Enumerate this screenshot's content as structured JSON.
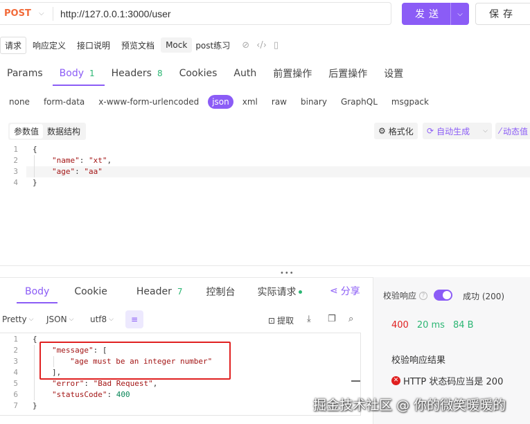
{
  "request": {
    "method": "POST",
    "url": "http://127.0.0.1:3000/user",
    "send_label": "发送",
    "save_label": "保存"
  },
  "subtabs": [
    {
      "label": "请求"
    },
    {
      "label": "响应定义"
    },
    {
      "label": "接口说明"
    },
    {
      "label": "预览文档"
    },
    {
      "label": "Mock"
    },
    {
      "label": "post练习"
    }
  ],
  "main_tabs": [
    {
      "label": "Params"
    },
    {
      "label": "Body",
      "count": "1"
    },
    {
      "label": "Headers",
      "count": "8"
    },
    {
      "label": "Cookies"
    },
    {
      "label": "Auth"
    },
    {
      "label": "前置操作"
    },
    {
      "label": "后置操作"
    },
    {
      "label": "设置"
    }
  ],
  "body_types": [
    "none",
    "form-data",
    "x-www-form-urlencoded",
    "json",
    "xml",
    "raw",
    "binary",
    "GraphQL",
    "msgpack"
  ],
  "editor": {
    "tabs": [
      "参数值",
      "数据结构"
    ],
    "format_label": "格式化",
    "auto_generate_label": "自动生成",
    "dynamic_label": "动态值"
  },
  "request_body": {
    "line_numbers": [
      "1",
      "2",
      "3",
      "4"
    ],
    "l1": "{",
    "l2_key": "\"name\"",
    "l2_val": "\"xt\"",
    "l3_key": "\"age\"",
    "l3_val": "\"aa\"",
    "l4": "}"
  },
  "response_tabs": [
    {
      "label": "Body"
    },
    {
      "label": "Cookie"
    },
    {
      "label": "Header",
      "count": "7"
    },
    {
      "label": "控制台"
    },
    {
      "label": "实际请求"
    }
  ],
  "share_label": "分享",
  "response_toolbar": {
    "view": "Pretty",
    "format": "JSON",
    "encoding": "utf8",
    "extract_label": "提取"
  },
  "response_body": {
    "line_numbers": [
      "1",
      "2",
      "3",
      "4",
      "5",
      "6",
      "7"
    ],
    "l1": "{",
    "l2_key": "\"message\"",
    "l2_rest": ": [",
    "l3_val": "\"age must be an integer number\"",
    "l4": "],",
    "l5_key": "\"error\"",
    "l5_val": "\"Bad Request\"",
    "l6_key": "\"statusCode\"",
    "l6_val": "400",
    "l7": "}"
  },
  "validation": {
    "label": "校验响应",
    "result_status": "成功 (200)",
    "status_code": "400",
    "time": "20 ms",
    "size": "84 B",
    "results_title": "校验响应结果",
    "result_item": "HTTP 状态码应当是 200"
  },
  "watermark": "掘金技术社区 @ 你的微笑暖暖的",
  "colors": {
    "accent": "#8b5cf6",
    "method": "#f26b3a",
    "success": "#2bb673",
    "error": "#e02020"
  }
}
